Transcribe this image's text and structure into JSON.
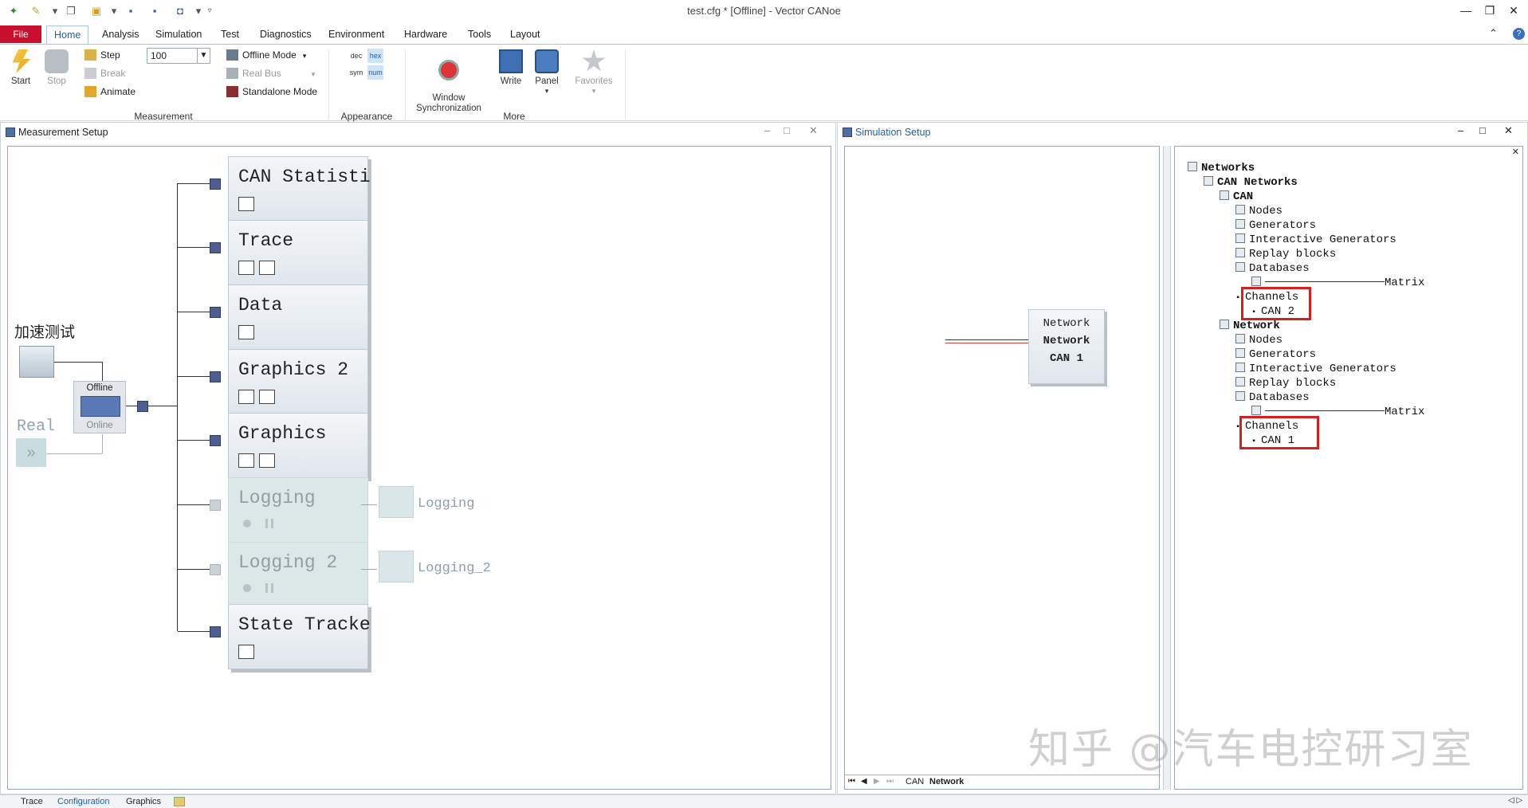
{
  "window": {
    "title": "test.cfg * [Offline] - Vector CANoe"
  },
  "menu": {
    "file": "File",
    "tabs": [
      "Home",
      "Analysis",
      "Simulation",
      "Test",
      "Diagnostics",
      "Environment",
      "Hardware",
      "Tools",
      "Layout"
    ]
  },
  "ribbon": {
    "start": "Start",
    "stop": "Stop",
    "step": "Step",
    "break": "Break",
    "animate": "Animate",
    "speed_value": "100",
    "offline_mode": "Offline Mode",
    "real_bus": "Real Bus",
    "standalone_mode": "Standalone Mode",
    "fmt_dec": "dec",
    "fmt_hex": "hex",
    "fmt_sym": "sym",
    "fmt_num": "num",
    "window_sync": "Window\nSynchronization",
    "write": "Write",
    "panel": "Panel",
    "favorites": "Favorites",
    "groups": {
      "measurement": "Measurement",
      "appearance": "Appearance",
      "more": "More"
    }
  },
  "measurement_setup": {
    "title": "Measurement Setup",
    "source_label": "加速测试",
    "real_label": "Real",
    "switch_offline": "Offline",
    "switch_online": "Online",
    "blocks": [
      "CAN Statisti",
      "Trace",
      "Data",
      "Graphics 2",
      "Graphics",
      "Logging",
      "Logging 2",
      "State Tracke"
    ],
    "log_files": [
      "Logging",
      "Logging_2"
    ]
  },
  "simulation_setup": {
    "title": "Simulation Setup",
    "bus_node": {
      "line1": "Network",
      "line2": "Network",
      "line3": "CAN 1"
    },
    "bottom_tabs": [
      "CAN",
      "Network"
    ],
    "tree": {
      "root": "Networks",
      "can_networks": "CAN Networks",
      "can": "CAN",
      "network": "Network",
      "nodes": "Nodes",
      "generators": "Generators",
      "interactive_generators": "Interactive Generators",
      "replay_blocks": "Replay blocks",
      "databases": "Databases",
      "matrix": "Matrix",
      "channels": "Channels",
      "can2": "CAN 2",
      "can1": "CAN 1"
    }
  },
  "statusbar": {
    "tabs": [
      "Trace",
      "Configuration",
      "Graphics"
    ]
  },
  "watermark": "知乎 @汽车电控研习室",
  "colors": {
    "file_tab": "#c8102e",
    "accent": "#1f5fa8",
    "highlight_box": "#d61f1f"
  }
}
